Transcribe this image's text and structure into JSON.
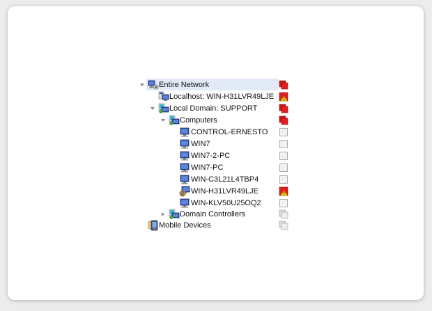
{
  "tree": {
    "entire_network": {
      "label": "Entire Network",
      "icon": "network-icon",
      "status": "alert-red",
      "expanded": true
    },
    "localhost": {
      "label": "Localhost: WIN-H31LVR49LJE",
      "icon": "localhost-computer-icon",
      "status": "warning-red"
    },
    "local_domain": {
      "label": "Local Domain: SUPPORT",
      "icon": "domain-icon",
      "status": "alert-red",
      "expanded": true
    },
    "computers": {
      "label": "Computers",
      "icon": "computers-group-icon",
      "status": "alert-red",
      "expanded": true
    },
    "computer_items": [
      {
        "label": "CONTROL-ERNESTO",
        "icon": "computer-icon",
        "status": "empty"
      },
      {
        "label": "WIN7",
        "icon": "computer-icon",
        "status": "empty"
      },
      {
        "label": "WIN7-2-PC",
        "icon": "computer-icon",
        "status": "empty"
      },
      {
        "label": "WIN7-PC",
        "icon": "computer-icon",
        "status": "empty"
      },
      {
        "label": "WIN-C3L21L4TBP4",
        "icon": "computer-icon",
        "status": "empty"
      },
      {
        "label": "WIN-H31LVR49LJE",
        "icon": "computer-globe-icon",
        "status": "warning-red"
      },
      {
        "label": "WIN-KLV50U25OQ2",
        "icon": "computer-icon",
        "status": "empty"
      }
    ],
    "domain_controllers": {
      "label": "Domain Controllers",
      "icon": "domain-controllers-icon",
      "status": "grey-stack",
      "expanded": false
    },
    "mobile_devices": {
      "label": "Mobile Devices",
      "icon": "mobile-device-icon",
      "status": "grey-stack"
    }
  },
  "colors": {
    "selection": "#e3eaf7",
    "alert_red": "#e02020",
    "warning_yellow": "#ffd700",
    "status_empty": "#f2f2f2"
  }
}
